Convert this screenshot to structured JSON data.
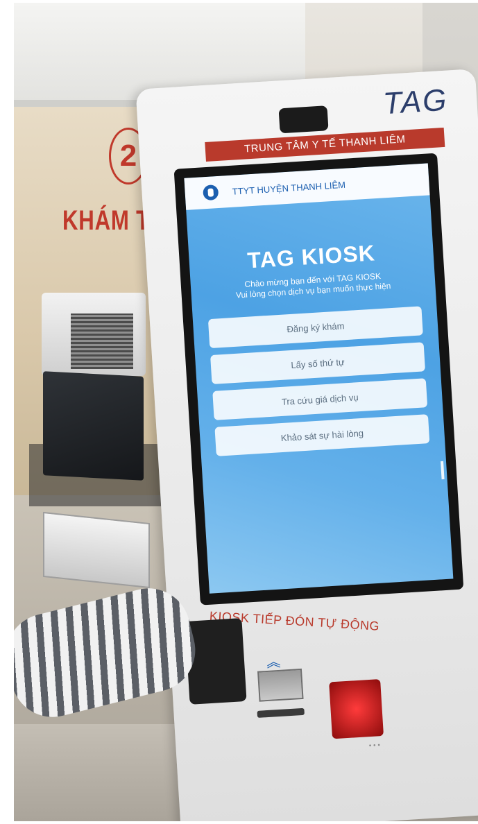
{
  "environment": {
    "room_number": "2",
    "room_sign": "KHÁM THƯ"
  },
  "kiosk": {
    "brand": "TAG",
    "header_banner": "TRUNG TÂM Y TẾ THANH LIÊM",
    "caption": "KIOSK TIẾP ĐÓN TỰ ĐỘNG"
  },
  "screen": {
    "header_title": "TTYT HUYỆN THANH LIÊM",
    "title": "TAG KIOSK",
    "subtitle_line1": "Chào mừng bạn đến với TAG KIOSK",
    "subtitle_line2": "Vui lòng chọn dịch vụ bạn muốn thực hiện",
    "menu": [
      {
        "label": "Đăng ký khám"
      },
      {
        "label": "Lấy số thứ tự"
      },
      {
        "label": "Tra cứu giá dịch vụ"
      },
      {
        "label": "Khảo sát sự hài lòng"
      }
    ]
  },
  "colors": {
    "accent_red": "#b93a2c",
    "screen_blue": "#4da2e4",
    "brand_navy": "#2c3e6b"
  },
  "icons": {
    "header_logo": "medical-logo-icon",
    "scan_prompt": "chevron-up-icon"
  }
}
